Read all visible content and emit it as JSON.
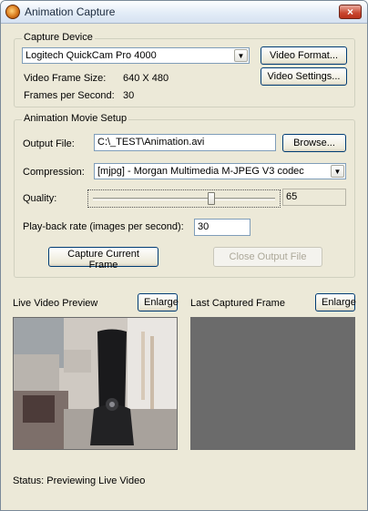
{
  "window": {
    "title": "Animation Capture",
    "close_glyph": "×"
  },
  "capture_device": {
    "group_label": "Capture Device",
    "device_selected": "Logitech QuickCam Pro 4000",
    "video_format_label": "Video Format...",
    "video_settings_label": "Video Settings...",
    "frame_size_label": "Video Frame Size:",
    "frame_size_value": "640 X 480",
    "fps_label": "Frames per Second:",
    "fps_value": "30"
  },
  "movie_setup": {
    "group_label": "Animation Movie Setup",
    "output_file_label": "Output File:",
    "output_file_value": "C:\\_TEST\\Animation.avi",
    "browse_label": "Browse...",
    "compression_label": "Compression:",
    "compression_value": "[mjpg] - Morgan Multimedia M-JPEG V3 codec",
    "quality_label": "Quality:",
    "quality_value": "65",
    "playback_label": "Play-back rate (images per second):",
    "playback_value": "30",
    "capture_frame_label": "Capture Current Frame",
    "close_output_label": "Close Output File"
  },
  "previews": {
    "live_label": "Live Video Preview",
    "live_enlarge_label": "Enlarge",
    "last_label": "Last Captured Frame",
    "last_enlarge_label": "Enlarge"
  },
  "status": {
    "text": "Status:  Previewing Live Video"
  },
  "colors": {
    "face": "#ece9d8",
    "empty_frame": "#6b6b6b",
    "accent": "#003c74"
  }
}
